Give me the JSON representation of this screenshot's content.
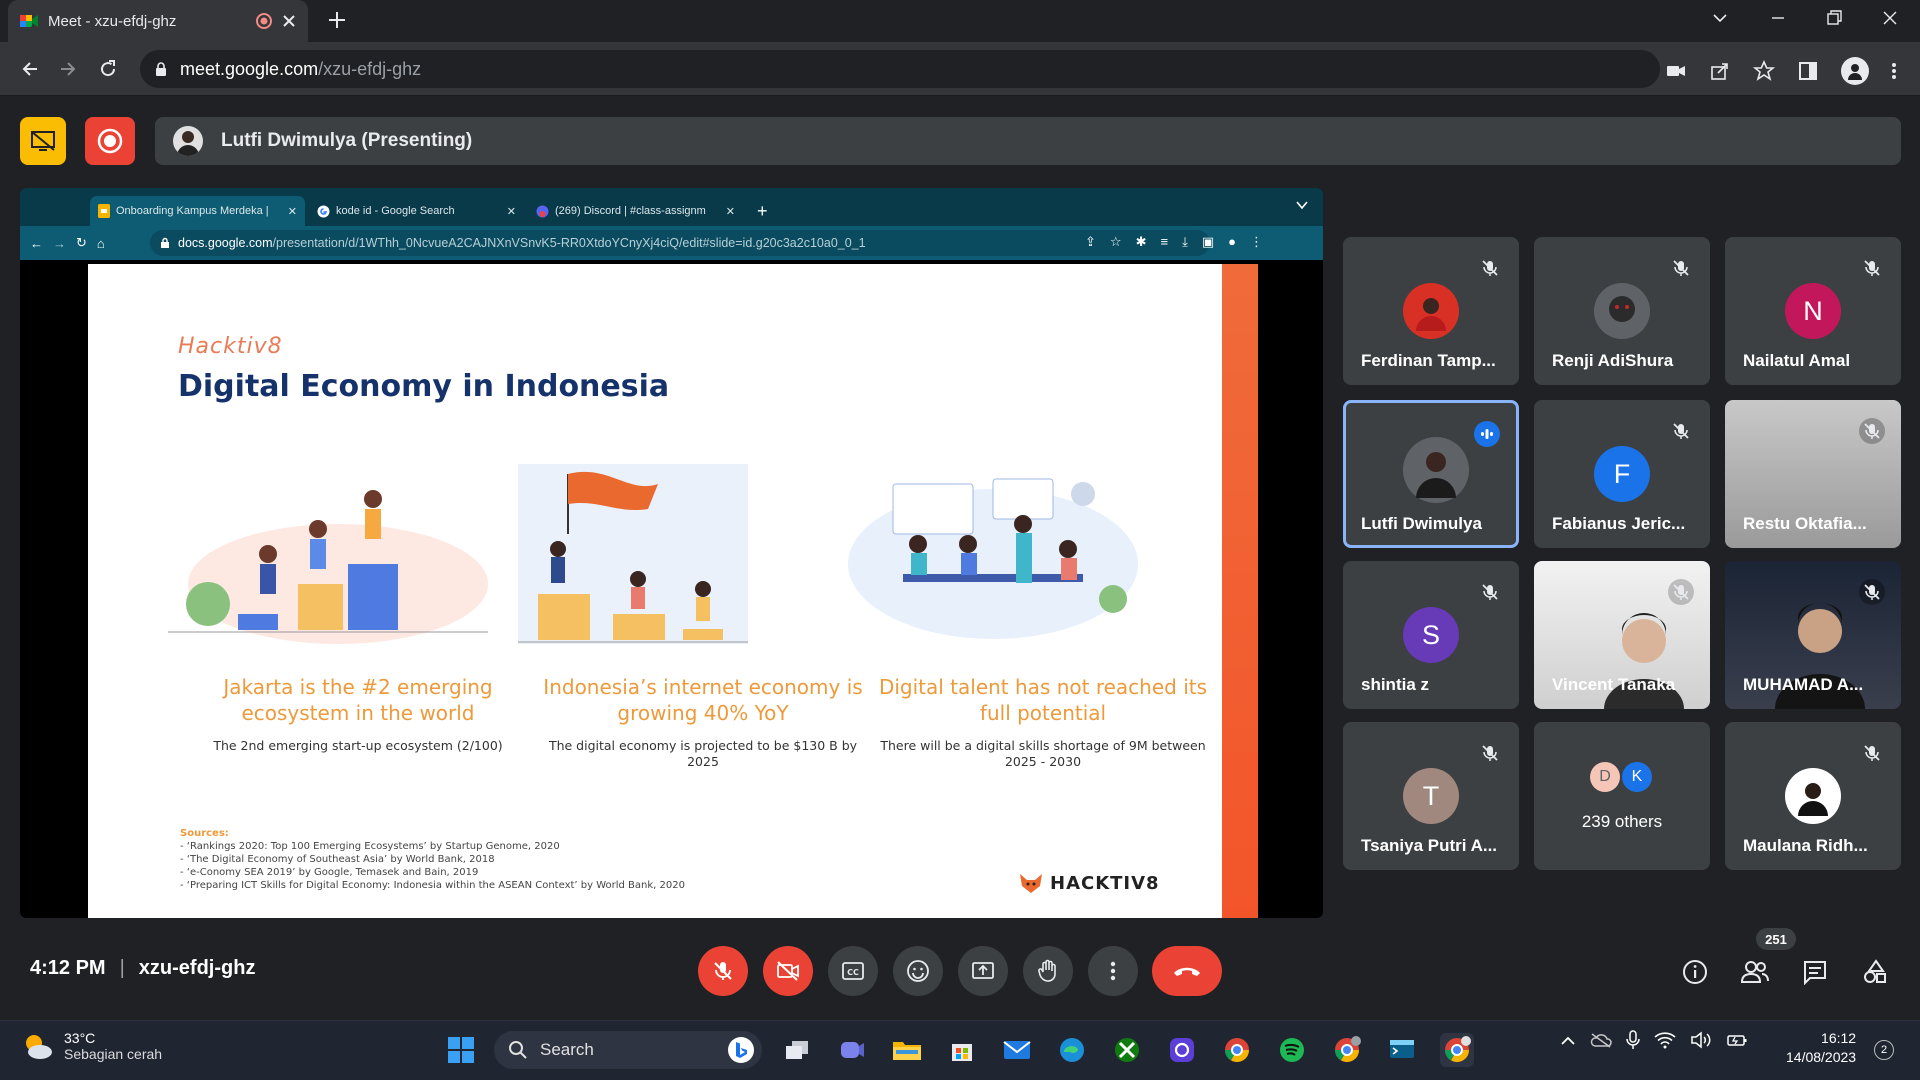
{
  "browser": {
    "tab_title": "Meet - xzu-efdj-ghz",
    "url_host": "meet.google.com",
    "url_path": "/xzu-efdj-ghz"
  },
  "meet": {
    "presenter_label": "Lutfi Dwimulya (Presenting)"
  },
  "shared_screen": {
    "tabs": [
      {
        "title": "Onboarding Kampus Merdeka |"
      },
      {
        "title": "kode id - Google Search"
      },
      {
        "title": "(269) Discord | #class-assignm"
      }
    ],
    "url_host": "docs.google.com",
    "url_path": "/presentation/d/1WThh_0NcvueA2CAJNXnVSnvK5-RR0XtdoYCnyXj4ciQ/edit#slide=id.g20c3a2c10a0_0_1",
    "slide": {
      "brand": "Hacktiv8",
      "title": "Digital Economy in Indonesia",
      "columns": [
        {
          "heading": "Jakarta is the #2 emerging ecosystem in the world",
          "detail": "The 2nd emerging start-up ecosystem (2/100)"
        },
        {
          "heading": "Indonesia’s internet economy is growing 40% YoY",
          "detail": "The digital economy is projected to be $130 B by 2025"
        },
        {
          "heading": "Digital talent has not reached its full potential",
          "detail": "There will be a digital skills shortage of 9M between 2025 - 2030"
        }
      ],
      "sources_label": "Sources:",
      "sources": [
        "- ‘Rankings 2020: Top 100 Emerging Ecosystems’ by Startup Genome, 2020",
        "- ‘The Digital Economy of Southeast Asia’ by World Bank, 2018",
        "- ‘e-Conomy SEA 2019’ by Google, Temasek and Bain, 2019",
        "- ‘Preparing ICT Skills for Digital Economy: Indonesia within the ASEAN Context’ by World Bank, 2020"
      ],
      "logo_text": "HACKTIV8"
    }
  },
  "participants": [
    {
      "name": "Ferdinan Tamp...",
      "initial": "",
      "color": "#d93025"
    },
    {
      "name": "Renji AdiShura",
      "initial": "",
      "color": "#5f6368"
    },
    {
      "name": "Nailatul Amal",
      "initial": "N",
      "color": "#c2185b"
    },
    {
      "name": "Lutfi Dwimulya",
      "initial": "",
      "color": "#5f6368"
    },
    {
      "name": "Fabianus Jeric...",
      "initial": "F",
      "color": "#1a73e8"
    },
    {
      "name": "Restu Oktafia...",
      "initial": "",
      "color": "#9e9e9e"
    },
    {
      "name": "shintia z",
      "initial": "S",
      "color": "#673ab7"
    },
    {
      "name": "Vincent Tanaka",
      "initial": "",
      "color": "#cfcfcf"
    },
    {
      "name": "MUHAMAD A...",
      "initial": "",
      "color": "#1b2435"
    },
    {
      "name": "Tsaniya Putri A...",
      "initial": "T",
      "color": "#a1887f"
    },
    {
      "name": "239 others",
      "initial": "",
      "color": "#3c4043"
    },
    {
      "name": "Maulana Ridh...",
      "initial": "",
      "color": "#ffffff"
    }
  ],
  "others_avatars": [
    "D",
    "K"
  ],
  "bottom": {
    "time": "4:12 PM",
    "meeting_code": "xzu-efdj-ghz",
    "people_count": "251"
  },
  "taskbar": {
    "temperature": "33°C",
    "weather_desc": "Sebagian cerah",
    "search_label": "Search",
    "time": "16:12",
    "date": "14/08/2023",
    "notifications": "2"
  }
}
